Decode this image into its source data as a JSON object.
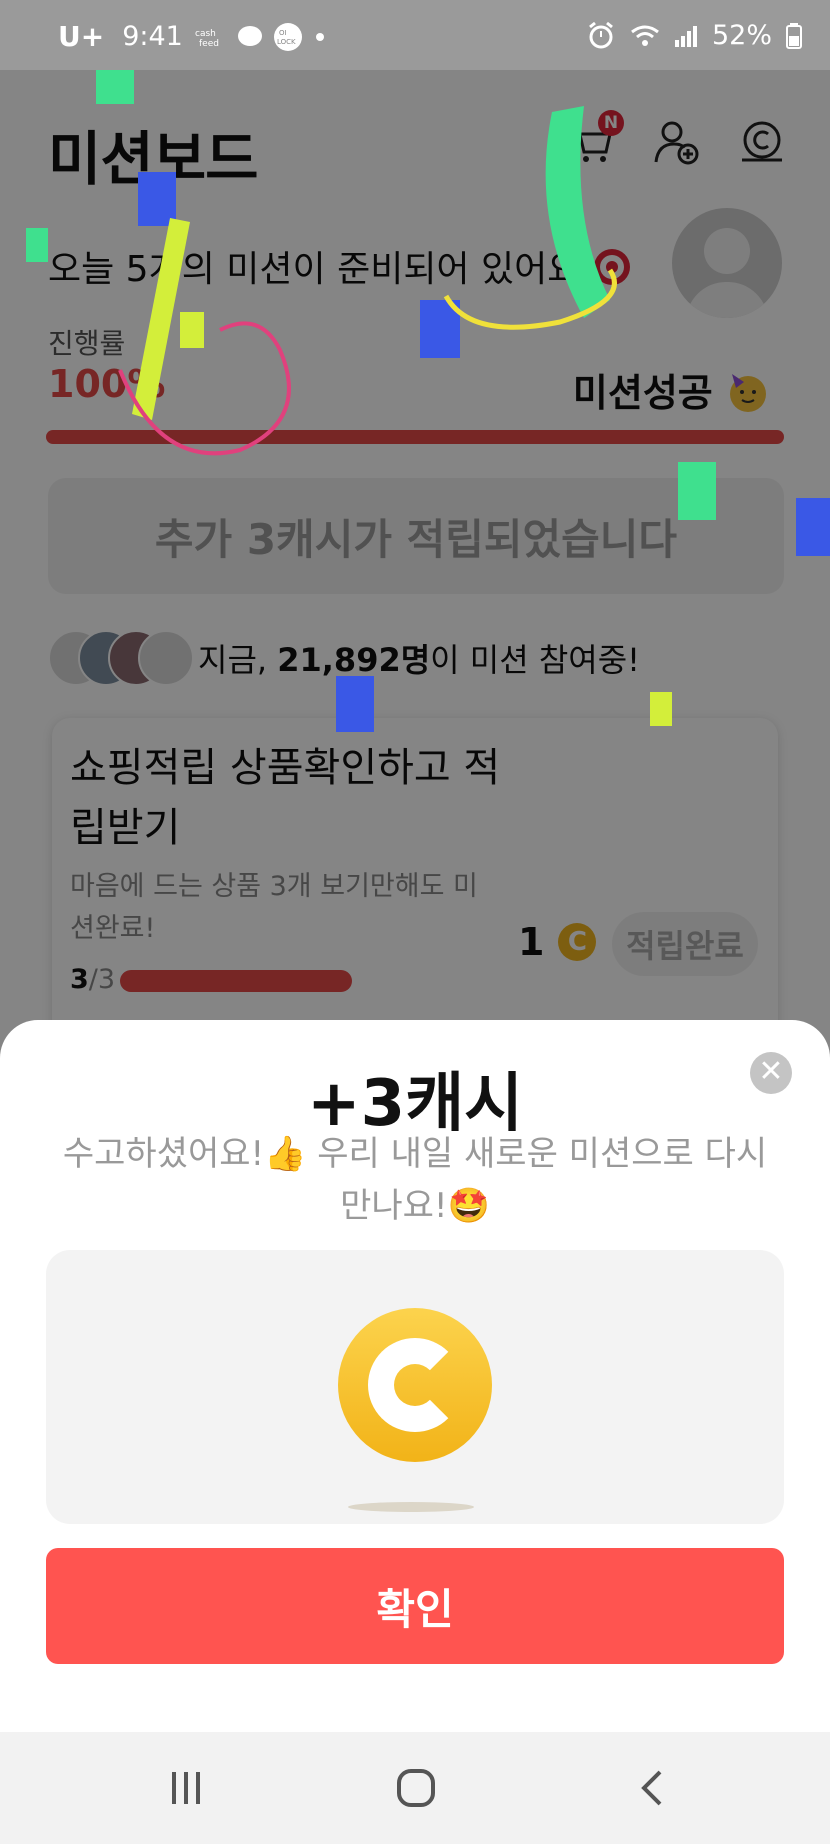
{
  "status_bar": {
    "carrier": "U+",
    "time": "9:41",
    "battery": "52%"
  },
  "header": {
    "title": "미션보드",
    "cart_badge": "N"
  },
  "greeting": {
    "sub": "오늘 5개의 미션이 준비되어 있어요"
  },
  "progress": {
    "label": "진행률",
    "value": "100%",
    "status": "미션성공",
    "fraction": 1.0
  },
  "banner": {
    "text": "추가 3캐시가 적립되었습니다"
  },
  "participants": {
    "prefix": "지금, ",
    "count": "21,892명",
    "suffix": "이 미션 참여중!"
  },
  "mission_card": {
    "title": "쇼핑적립 상품확인하고 적립받기",
    "description": "마음에 드는 상품 3개 보기만해도 미션완료!",
    "count_done": "3",
    "count_total": "/3",
    "reward": "1",
    "button": "적립완료"
  },
  "sheet": {
    "title": "+3캐시",
    "message_line1": "수고하셨어요!👍 우리 내일 새로운 미션으로 다시",
    "message_line2": "만나요!🤩",
    "confirm": "확인"
  },
  "colors": {
    "accent": "#ff5450",
    "progress": "#e54a48",
    "coin": "#f2b318"
  },
  "icons": [
    "cart-icon",
    "add-friend-icon",
    "cash-icon",
    "target-icon",
    "party-face-icon",
    "close-icon",
    "coin-icon",
    "recent-apps-icon",
    "home-icon",
    "back-icon"
  ]
}
